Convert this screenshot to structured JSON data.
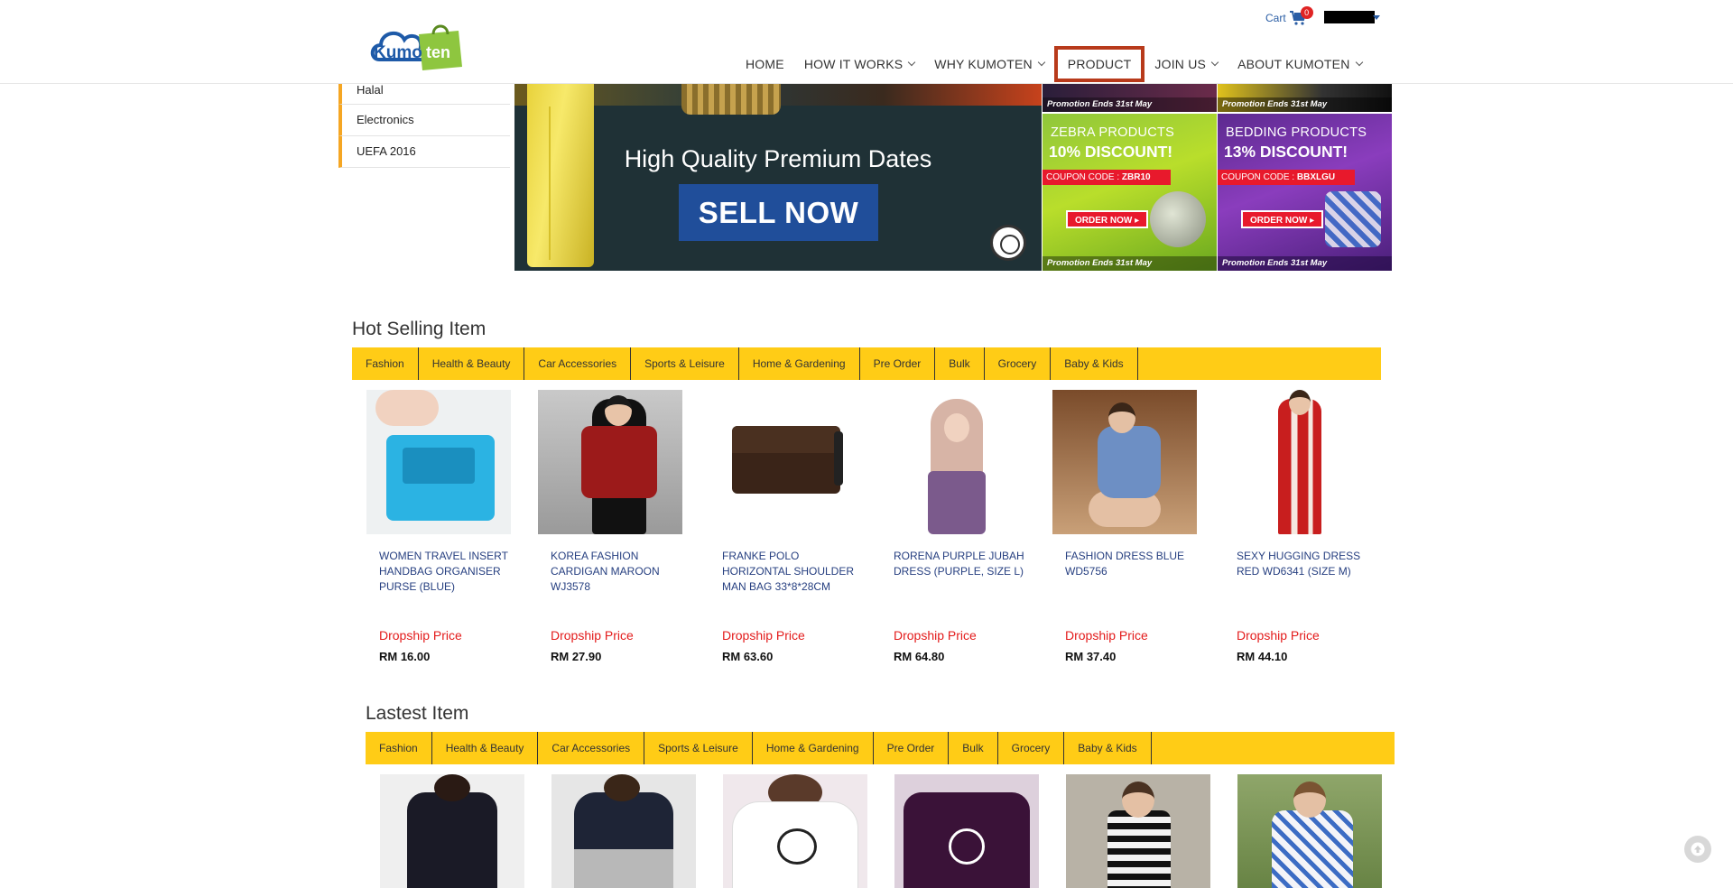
{
  "header": {
    "logo_text": "Kumoten",
    "cart_label": "Cart",
    "cart_count": "0",
    "nav": [
      {
        "label": "HOME",
        "dropdown": false
      },
      {
        "label": "HOW IT WORKS",
        "dropdown": true
      },
      {
        "label": "WHY KUMOTEN",
        "dropdown": true
      },
      {
        "label": "PRODUCT",
        "dropdown": false,
        "active": true
      },
      {
        "label": "JOIN US",
        "dropdown": true
      },
      {
        "label": "ABOUT KUMOTEN",
        "dropdown": true
      }
    ]
  },
  "sidebar": {
    "items": [
      "Halal",
      "Electronics",
      "UEFA 2016"
    ]
  },
  "banner": {
    "title": "High Quality Premium Dates",
    "button": "SELL NOW",
    "promos": {
      "top_left_strip": "Promotion Ends 31st May",
      "top_right_strip": "Promotion Ends 31st May",
      "zebra": {
        "title": "ZEBRA PRODUCTS",
        "discount": "10% DISCOUNT!",
        "coupon_label": "COUPON CODE : ",
        "coupon_code": "ZBR10",
        "order": "ORDER NOW ▸",
        "strip": "Promotion Ends 31st May"
      },
      "bedding": {
        "title": "BEDDING PRODUCTS",
        "discount": "13% DISCOUNT!",
        "coupon_label": "COUPON CODE : ",
        "coupon_code": "BBXLGU",
        "order": "ORDER NOW ▸",
        "strip": "Promotion Ends 31st May"
      }
    }
  },
  "hot": {
    "title": "Hot Selling Item",
    "tabs": [
      "Fashion",
      "Health & Beauty",
      "Car Accessories",
      "Sports & Leisure",
      "Home & Gardening",
      "Pre Order",
      "Bulk",
      "Grocery",
      "Baby & Kids"
    ],
    "products": [
      {
        "name": "WOMEN TRAVEL INSERT HANDBAG ORGANISER PURSE (BLUE)",
        "label": "Dropship Price",
        "price": "RM 16.00"
      },
      {
        "name": "KOREA FASHION CARDIGAN MAROON WJ3578",
        "label": "Dropship Price",
        "price": "RM 27.90"
      },
      {
        "name": "FRANKE POLO HORIZONTAL SHOULDER MAN BAG 33*8*28CM",
        "label": "Dropship Price",
        "price": "RM 63.60"
      },
      {
        "name": "RORENA PURPLE JUBAH DRESS (PURPLE, SIZE L)",
        "label": "Dropship Price",
        "price": "RM 64.80"
      },
      {
        "name": "FASHION DRESS BLUE WD5756",
        "label": "Dropship Price",
        "price": "RM 37.40"
      },
      {
        "name": "SEXY HUGGING DRESS RED WD6341 (SIZE M)",
        "label": "Dropship Price",
        "price": "RM 44.10"
      }
    ]
  },
  "latest": {
    "title": "Lastest Item",
    "tabs": [
      "Fashion",
      "Health & Beauty",
      "Car Accessories",
      "Sports & Leisure",
      "Home & Gardening",
      "Pre Order",
      "Bulk",
      "Grocery",
      "Baby & Kids"
    ]
  },
  "colors": {
    "tab_bar": "#ffcc16",
    "nav_active_border": "#b83a1b",
    "sidebar_accent": "#f5a623",
    "price_label": "#e31b1b",
    "product_name": "#263f80"
  }
}
